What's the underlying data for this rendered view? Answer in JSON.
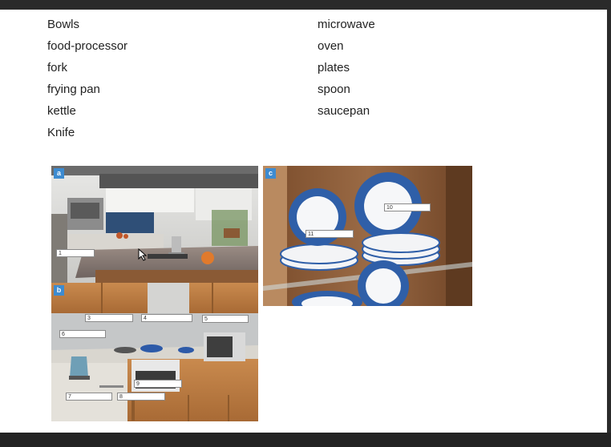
{
  "words": {
    "left": [
      "Bowls",
      "food-processor",
      "fork",
      "frying pan",
      "kettle",
      "Knife"
    ],
    "right": [
      "microwave",
      "oven",
      "plates",
      "spoon",
      "saucepan"
    ]
  },
  "photos": {
    "a": {
      "badge": "a",
      "labels": [
        "1"
      ]
    },
    "b": {
      "badge": "b",
      "labels": [
        "3",
        "4",
        "5",
        "6",
        "7",
        "8",
        "9"
      ]
    },
    "c": {
      "badge": "c",
      "labels": [
        "10",
        "11"
      ]
    }
  },
  "colors": {
    "badge": "#3d8bd0",
    "wood": "#8a5a35",
    "porcelain": "#2f5fa8"
  }
}
